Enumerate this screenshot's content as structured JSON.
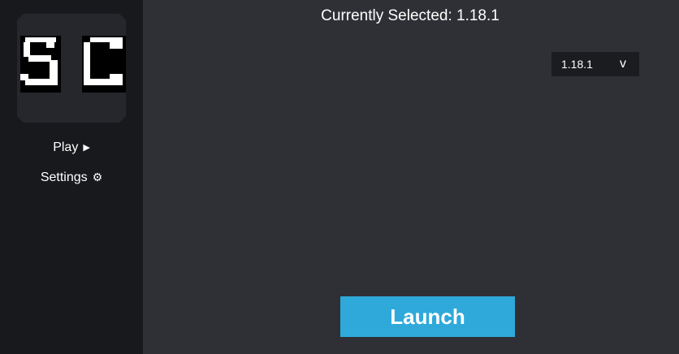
{
  "sidebar": {
    "logo_text": "SC",
    "items": [
      {
        "label": "Play",
        "icon": "play-icon",
        "glyph": "▶"
      },
      {
        "label": "Settings",
        "icon": "gear-icon",
        "glyph": "⚙"
      }
    ]
  },
  "main": {
    "current_label": "Currently Selected: 1.18.1",
    "version_select": {
      "selected": "1.18.1",
      "caret": "v"
    },
    "launch_label": "Launch"
  },
  "colors": {
    "sidebar_bg": "#18191c",
    "main_bg": "#2f3036",
    "select_bg": "#1b1c20",
    "accent": "#2ea9da",
    "text": "#ffffff"
  }
}
